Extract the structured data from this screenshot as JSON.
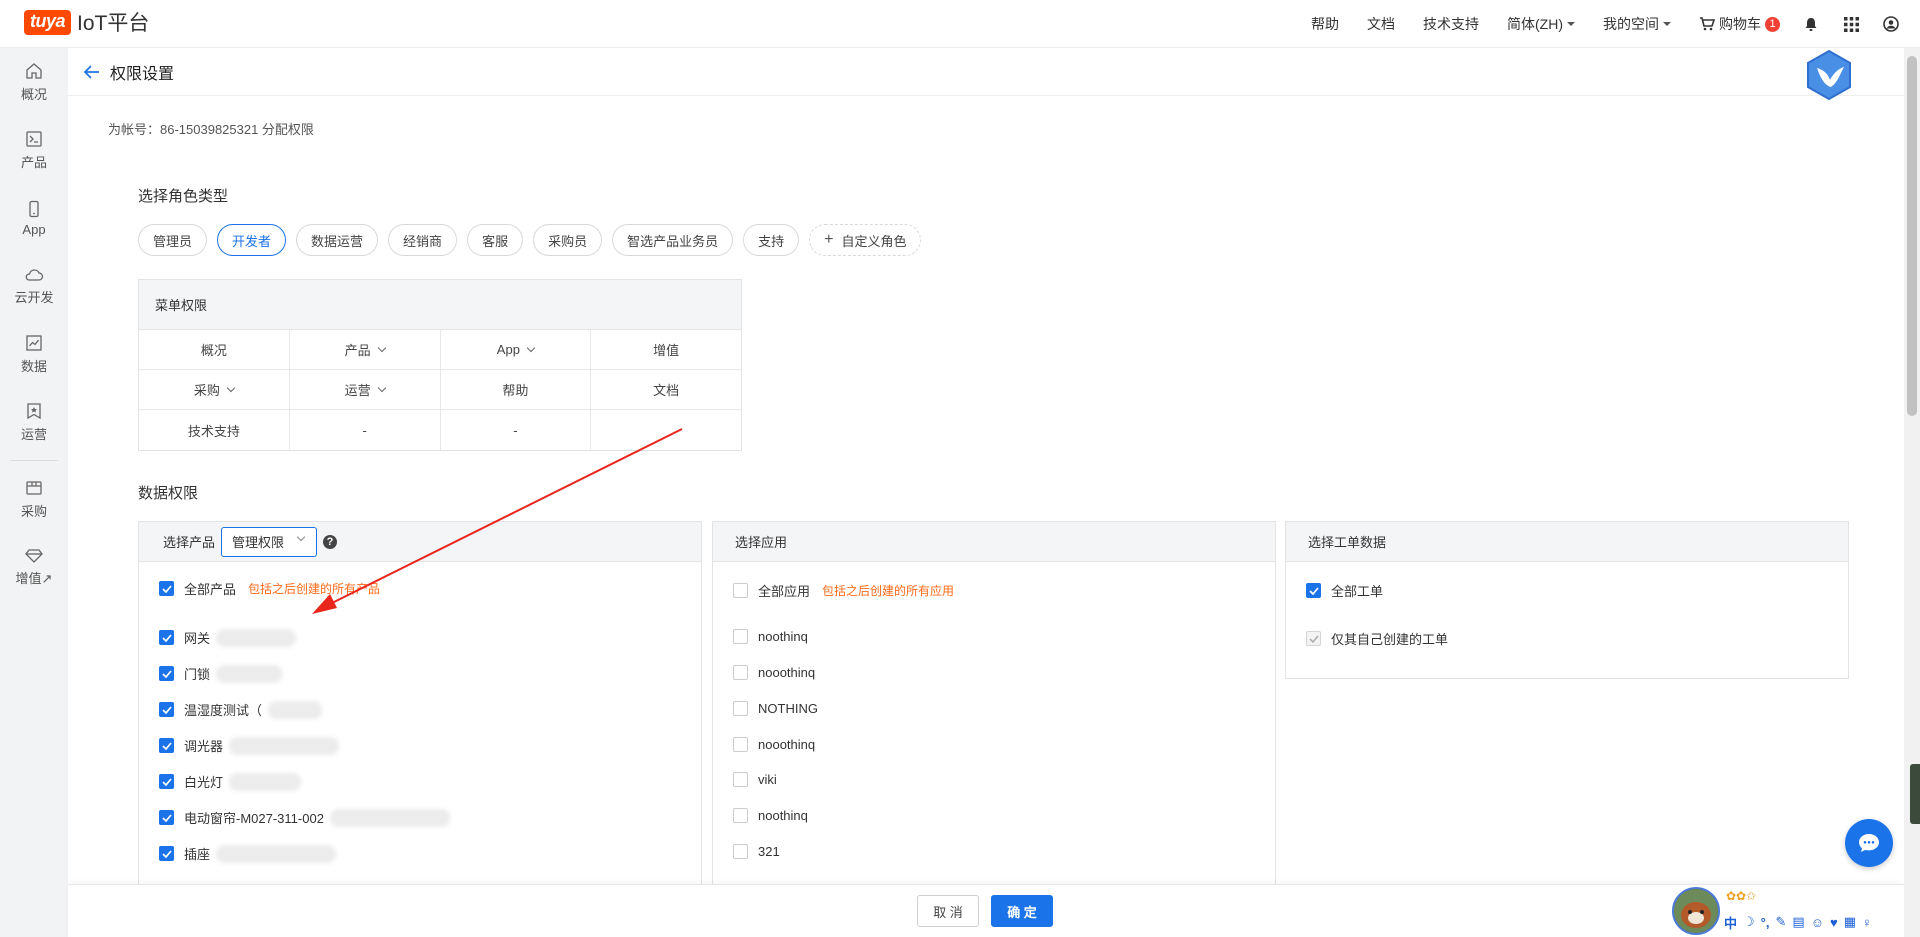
{
  "topbar": {
    "logo_badge": "tuya",
    "logo_text": "IoT平台",
    "nav": {
      "help": "帮助",
      "docs": "文档",
      "tech_support": "技术支持",
      "language": "简体(ZH)",
      "my_space": "我的空间",
      "cart": "购物车",
      "cart_count": "1"
    }
  },
  "sidebar": {
    "items": [
      {
        "label": "概况",
        "icon": "home-icon"
      },
      {
        "label": "产品",
        "icon": "terminal-icon"
      },
      {
        "label": "App",
        "icon": "phone-icon"
      },
      {
        "label": "云开发",
        "icon": "cloud-icon"
      },
      {
        "label": "数据",
        "icon": "chart-icon"
      },
      {
        "label": "运营",
        "icon": "bookmark-icon"
      },
      {
        "label": "采购",
        "icon": "box-icon"
      },
      {
        "label": "增值↗",
        "icon": "diamond-icon"
      }
    ]
  },
  "header": {
    "title": "权限设置"
  },
  "account_line": "为帐号：86-15039825321 分配权限",
  "role_section": {
    "title": "选择角色类型",
    "roles": [
      "管理员",
      "开发者",
      "数据运营",
      "经销商",
      "客服",
      "采购员",
      "智选产品业务员",
      "支持"
    ],
    "active_role": "开发者",
    "custom_label": "自定义角色"
  },
  "menu_permissions": {
    "title": "菜单权限",
    "rows": [
      [
        "概况",
        "产品",
        "App",
        "增值"
      ],
      [
        "采购",
        "运营",
        "帮助",
        "文档"
      ],
      [
        "技术支持",
        "-",
        "-",
        ""
      ]
    ]
  },
  "data_section": {
    "title": "数据权限"
  },
  "product_panel": {
    "label": "选择产品",
    "select_value": "管理权限",
    "help_glyph": "?",
    "all_label": "全部产品",
    "all_hint": "包括之后创建的所有产品",
    "items": [
      "网关",
      "门锁",
      "温湿度测试（",
      "调光器",
      "白光灯",
      "电动窗帘-M027-311-002",
      "插座"
    ]
  },
  "app_panel": {
    "label": "选择应用",
    "all_label": "全部应用",
    "all_hint": "包括之后创建的所有应用",
    "items": [
      "noothinq",
      "nooothinq",
      "NOTHING",
      "nooothinq",
      "viki",
      "noothinq",
      "321"
    ]
  },
  "ticket_panel": {
    "label": "选择工单数据",
    "all_label": "全部工单",
    "own_label": "仅其自己创建的工单"
  },
  "footer": {
    "cancel": "取 消",
    "confirm": "确 定"
  },
  "ime": {
    "stars": "✿✿✩",
    "keys": [
      "中",
      "☽",
      "°,",
      "✎",
      "▤",
      "☺",
      "♥",
      "▦",
      "♀"
    ]
  },
  "colors": {
    "primary": "#1a73e8",
    "hint": "#ff6a1a",
    "brand": "#ff4800"
  }
}
